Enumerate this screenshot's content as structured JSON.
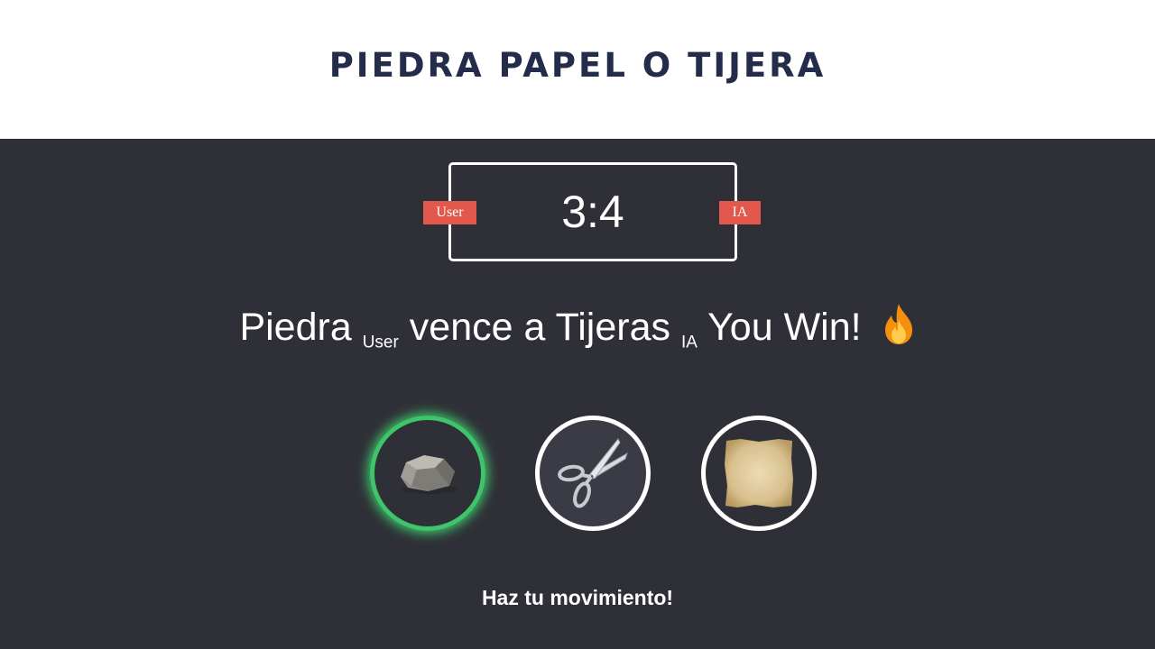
{
  "header": {
    "title": "PIEDRA PAPEL O TIJERA"
  },
  "scoreboard": {
    "score": "3:4",
    "user_label": "User",
    "ia_label": "IA"
  },
  "result": {
    "user_move": "Piedra",
    "user_tag": "User",
    "verb": "vence a",
    "ia_move": "Tijeras",
    "ia_tag": "IA",
    "outcome": "You Win!",
    "icon": "fire-icon"
  },
  "choices": [
    {
      "name": "rock",
      "icon": "rock-icon",
      "selected": true
    },
    {
      "name": "scissors",
      "icon": "scissors-icon",
      "selected": false
    },
    {
      "name": "paper",
      "icon": "paper-icon",
      "selected": false
    }
  ],
  "prompt": "Haz tu movimiento!",
  "colors": {
    "background": "#2f3037",
    "header_bg": "#ffffff",
    "title": "#232c4a",
    "badge": "#e2584d",
    "selected_ring": "#3ec46b"
  }
}
